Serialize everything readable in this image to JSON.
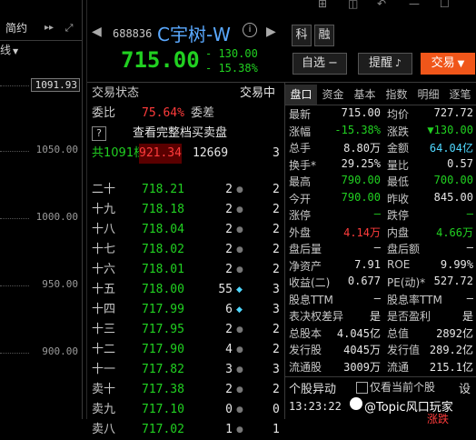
{
  "window": {
    "controls_left": "⊞",
    "controls_mid": "◫",
    "controls_undo": "↶",
    "controls_min": "—",
    "controls_max": "☐"
  },
  "left_panel": {
    "tab_label": "简约",
    "menu_label": "线",
    "price_labels": [
      "1091.93",
      "1050.00",
      "1000.00",
      "950.00",
      "900.00"
    ]
  },
  "header": {
    "code": "688836",
    "name": "C宇树-W",
    "price": "715.00",
    "change": "- 130.00",
    "change_pct": "- 15.38%",
    "btn_ke": "科",
    "btn_rong": "融",
    "btn_watchlist": "自选",
    "btn_alert": "提醒",
    "btn_trade": "交易"
  },
  "depth": {
    "status_label": "交易状态",
    "status_value": "交易中",
    "weibi_label": "委比",
    "weibi_value": "75.64%",
    "weicha_label": "委差",
    "full_book_q": "?",
    "full_book_label": "查看完整档买卖盘",
    "total_prefix": "共1091档",
    "total_price": "921.34",
    "total_volume": "12669",
    "total_count": "3",
    "levels": [
      {
        "label": "二十",
        "price": "718.21",
        "vol": "2",
        "cnt": "2",
        "red": false
      },
      {
        "label": "十九",
        "price": "718.18",
        "vol": "2",
        "cnt": "2",
        "red": false
      },
      {
        "label": "十八",
        "price": "718.04",
        "vol": "2",
        "cnt": "2",
        "red": false
      },
      {
        "label": "十七",
        "price": "718.02",
        "vol": "2",
        "cnt": "2",
        "red": false
      },
      {
        "label": "十六",
        "price": "718.01",
        "vol": "2",
        "cnt": "2",
        "red": false
      },
      {
        "label": "十五",
        "price": "718.00",
        "vol": "55",
        "cnt": "3",
        "red": true
      },
      {
        "label": "十四",
        "price": "717.99",
        "vol": "6",
        "cnt": "3",
        "red": true
      },
      {
        "label": "十三",
        "price": "717.95",
        "vol": "2",
        "cnt": "2",
        "red": false
      },
      {
        "label": "十二",
        "price": "717.90",
        "vol": "4",
        "cnt": "2",
        "red": false
      },
      {
        "label": "十一",
        "price": "717.82",
        "vol": "3",
        "cnt": "3",
        "red": false
      },
      {
        "label": "卖十",
        "price": "717.38",
        "vol": "2",
        "cnt": "2",
        "red": false
      },
      {
        "label": "卖九",
        "price": "717.10",
        "vol": "0",
        "cnt": "0",
        "red": false
      },
      {
        "label": "卖八",
        "price": "717.02",
        "vol": "1",
        "cnt": "1",
        "red": false
      }
    ]
  },
  "tabs": [
    "盘口",
    "资金",
    "基本",
    "指数",
    "明细",
    "逐笔"
  ],
  "quote": {
    "rows": [
      {
        "l1": "最新",
        "v1": "715.00",
        "c1": "white",
        "l2": "均价",
        "v2": "727.72",
        "c2": "white"
      },
      {
        "l1": "涨幅",
        "v1": "-15.38%",
        "c1": "green",
        "l2": "涨跌",
        "v2": "▼130.00",
        "c2": "green"
      },
      {
        "l1": "总手",
        "v1": "8.80万",
        "c1": "white",
        "l2": "金额",
        "v2": "64.04亿",
        "c2": "cyan"
      },
      {
        "l1": "换手*",
        "v1": "29.25%",
        "c1": "white",
        "l2": "量比",
        "v2": "0.57",
        "c2": "white"
      },
      {
        "l1": "最高",
        "v1": "790.00",
        "c1": "green",
        "l2": "最低",
        "v2": "700.00",
        "c2": "green"
      },
      {
        "l1": "今开",
        "v1": "790.00",
        "c1": "green",
        "l2": "昨收",
        "v2": "845.00",
        "c2": "white"
      },
      {
        "l1": "涨停",
        "v1": "—",
        "c1": "green",
        "l2": "跌停",
        "v2": "—",
        "c2": "green"
      },
      {
        "l1": "外盘",
        "v1": "4.14万",
        "c1": "red",
        "l2": "内盘",
        "v2": "4.66万",
        "c2": "green"
      },
      {
        "l1": "盘后量",
        "v1": "—",
        "c1": "white",
        "l2": "盘后额",
        "v2": "—",
        "c2": "white"
      },
      {
        "l1": "净资产",
        "v1": "7.91",
        "c1": "white",
        "l2": "ROE",
        "v2": "9.99%",
        "c2": "white"
      },
      {
        "l1": "收益(二)",
        "v1": "0.677",
        "c1": "white",
        "l2": "PE(动)*",
        "v2": "527.72",
        "c2": "white"
      },
      {
        "l1": "股息TTM",
        "v1": "—",
        "c1": "white",
        "l2": "股息率TTM",
        "v2": "—",
        "c2": "white"
      },
      {
        "l1": "表决权差异",
        "v1": "是",
        "c1": "white",
        "l2": "是否盈利",
        "v2": "是",
        "c2": "white"
      },
      {
        "l1": "总股本",
        "v1": "4.045亿",
        "c1": "white",
        "l2": "总值",
        "v2": "2892亿",
        "c2": "white"
      },
      {
        "l1": "发行股",
        "v1": "4045万",
        "c1": "white",
        "l2": "发行值",
        "v2": "289.2亿",
        "c2": "white"
      },
      {
        "l1": "流通股",
        "v1": "3009万",
        "c1": "white",
        "l2": "流通",
        "v2": "215.1亿",
        "c2": "white"
      }
    ]
  },
  "anomaly": {
    "title": "个股异动",
    "checkbox_label": "仅看当前个股",
    "settings_label": "设",
    "time": "13:23:22",
    "event_text": "涨跌",
    "watermark": "@Topic风口玩家"
  }
}
